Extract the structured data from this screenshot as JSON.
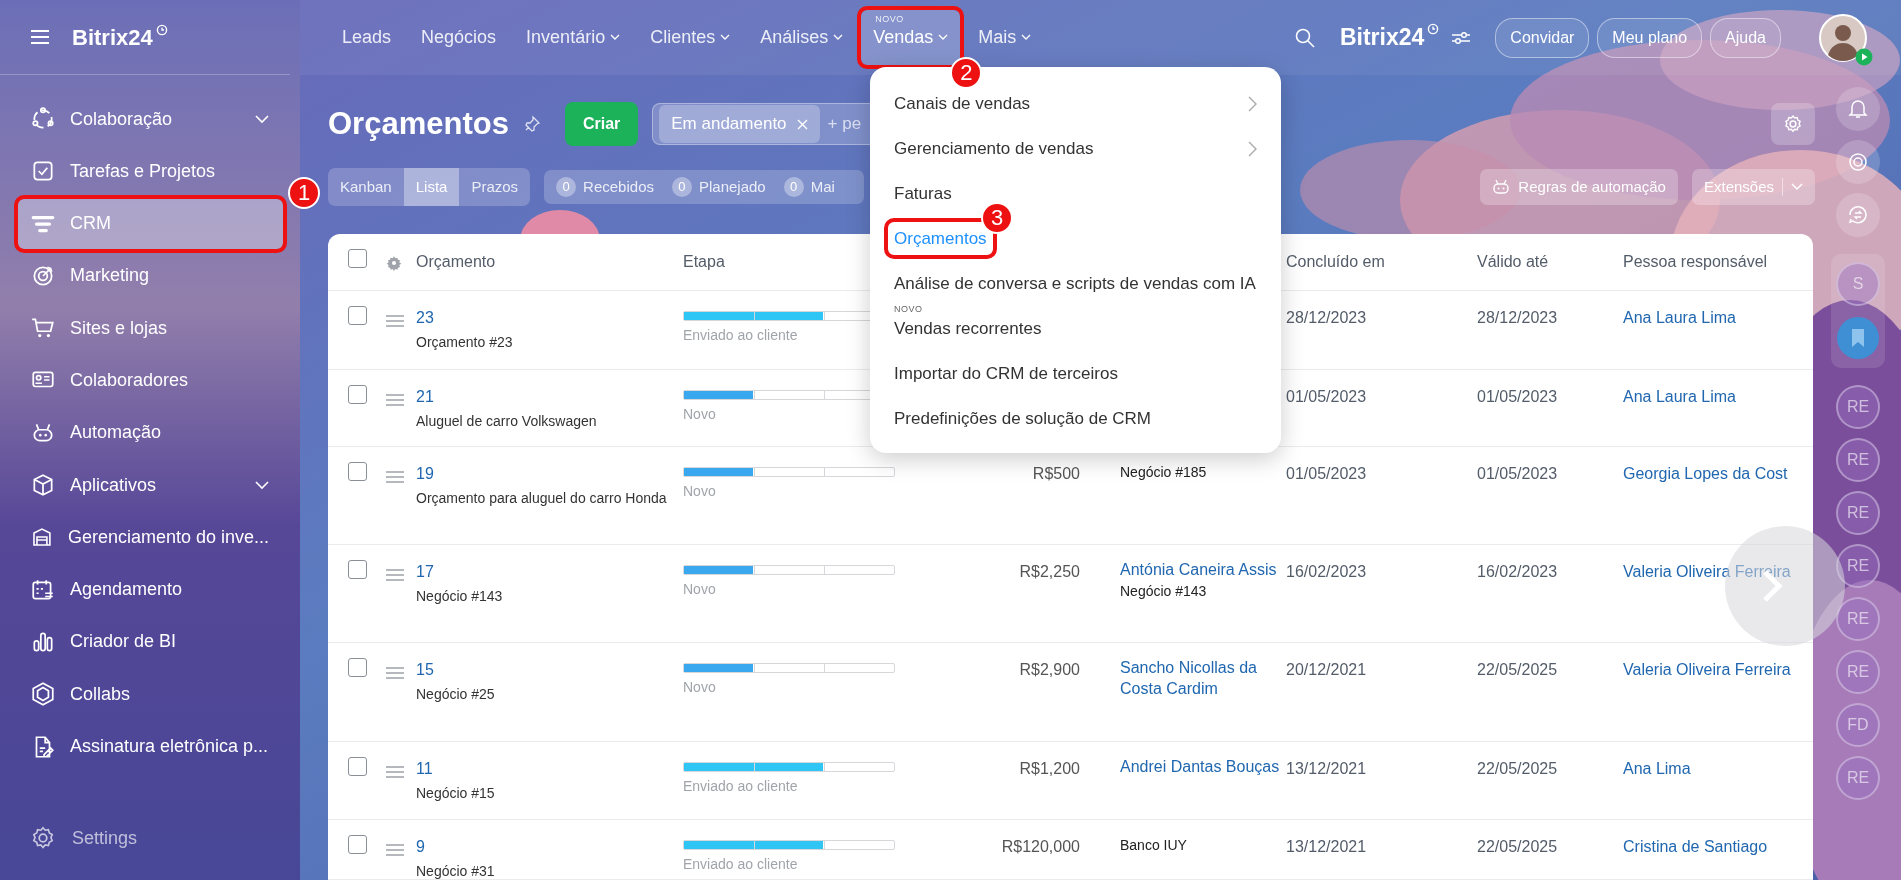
{
  "sidebar": {
    "logo": "Bitrix24",
    "items": [
      {
        "label": "Colaboração",
        "expandable": true,
        "selected": false
      },
      {
        "label": "Tarefas e Projetos",
        "expandable": false,
        "selected": false
      },
      {
        "label": "CRM",
        "expandable": false,
        "selected": true,
        "callout": "1"
      },
      {
        "label": "Marketing",
        "expandable": false,
        "selected": false
      },
      {
        "label": "Sites e lojas",
        "expandable": false,
        "selected": false
      },
      {
        "label": "Colaboradores",
        "expandable": false,
        "selected": false
      },
      {
        "label": "Automação",
        "expandable": false,
        "selected": false
      },
      {
        "label": "Aplicativos",
        "expandable": true,
        "selected": false
      },
      {
        "label": "Gerenciamento do inve...",
        "expandable": false,
        "selected": false
      },
      {
        "label": "Agendamento",
        "expandable": false,
        "selected": false
      },
      {
        "label": "Criador de BI",
        "expandable": false,
        "selected": false
      },
      {
        "label": "Collabs",
        "expandable": false,
        "selected": false
      },
      {
        "label": "Assinatura eletrônica p...",
        "expandable": false,
        "selected": false
      }
    ],
    "settings": "Settings"
  },
  "topbar": {
    "nav": [
      {
        "label": "Leads",
        "dropdown": false,
        "selected": false
      },
      {
        "label": "Negócios",
        "dropdown": false,
        "selected": false
      },
      {
        "label": "Inventário",
        "dropdown": true,
        "selected": false
      },
      {
        "label": "Clientes",
        "dropdown": true,
        "selected": false
      },
      {
        "label": "Análises",
        "dropdown": true,
        "selected": false
      },
      {
        "label": "Vendas",
        "dropdown": true,
        "selected": true,
        "badge": "NOVO",
        "callout": "2"
      },
      {
        "label": "Mais",
        "dropdown": true,
        "selected": false
      }
    ],
    "logo": "Bitrix24",
    "buttons": [
      "Convidar",
      "Meu plano",
      "Ajuda"
    ]
  },
  "menu": {
    "items": [
      {
        "label": "Canais de vendas",
        "submenu": true,
        "selected": false
      },
      {
        "label": "Gerenciamento de vendas",
        "submenu": true,
        "selected": false
      },
      {
        "label": "Faturas",
        "submenu": false,
        "selected": false
      },
      {
        "label": "Orçamentos",
        "submenu": false,
        "selected": true,
        "callout": "3"
      },
      {
        "label": "Análise de conversa e scripts de vendas com IA",
        "submenu": false,
        "selected": false
      },
      {
        "label": "Vendas recorrentes",
        "submenu": false,
        "selected": false,
        "badge": "NOVO"
      },
      {
        "label": "Importar do CRM de terceiros",
        "submenu": false,
        "selected": false
      },
      {
        "label": "Predefinições de solução de CRM",
        "submenu": false,
        "selected": false
      }
    ]
  },
  "page": {
    "title": "Orçamentos",
    "create_button": "Criar",
    "filter": {
      "chip": "Em andamento",
      "placeholder": "+ pe"
    },
    "views": [
      {
        "label": "Kanban",
        "selected": false
      },
      {
        "label": "Lista",
        "selected": true
      },
      {
        "label": "Prazos",
        "selected": false
      }
    ],
    "counters": [
      {
        "count": "0",
        "label": "Recebidos"
      },
      {
        "count": "0",
        "label": "Planejado"
      },
      {
        "count": "0",
        "label": "Mai"
      }
    ],
    "automation_button": "Regras de automação",
    "extensions_button": "Extensões"
  },
  "table": {
    "all_checked": false,
    "columns": [
      "Orçamento",
      "Etapa",
      "Concluído em",
      "Válido até",
      "Pessoa responsável"
    ],
    "rows": [
      {
        "checked": false,
        "number": "23",
        "title": "Orçamento #23",
        "stage": "Enviado ao cliente",
        "level": 0.66,
        "color": "#2fc6f6",
        "concluded": "28/12/2023",
        "valid": "28/12/2023",
        "responsible": "Ana Laura Lima"
      },
      {
        "checked": false,
        "number": "21",
        "title": "Aluguel de carro Volkswagen",
        "stage": "Novo",
        "level": 0.33,
        "color": "#39a8ef",
        "concluded": "01/05/2023",
        "valid": "01/05/2023",
        "responsible": "Ana Laura Lima"
      },
      {
        "checked": false,
        "number": "19",
        "title": "Orçamento para aluguel do carro Honda",
        "stage": "Novo",
        "level": 0.33,
        "color": "#39a8ef",
        "amount": "R$500",
        "client_note": "Negócio #185",
        "concluded": "01/05/2023",
        "valid": "01/05/2023",
        "responsible": "Georgia Lopes da Cost"
      },
      {
        "checked": false,
        "number": "17",
        "title": "Negócio #143",
        "stage": "Novo",
        "level": 0.33,
        "color": "#39a8ef",
        "amount": "R$2,250",
        "client": "Antónia Caneira Assis",
        "client_note": "Negócio #143",
        "concluded": "16/02/2023",
        "valid": "16/02/2023",
        "responsible": "Valeria Oliveira Ferreira"
      },
      {
        "checked": false,
        "number": "15",
        "title": "Negócio #25",
        "stage": "Novo",
        "level": 0.33,
        "color": "#39a8ef",
        "amount": "R$2,900",
        "client": "Sancho Nicollas da Costa Cardim",
        "concluded": "20/12/2021",
        "valid": "22/05/2025",
        "responsible": "Valeria Oliveira Ferreira"
      },
      {
        "checked": false,
        "number": "11",
        "title": "Negócio #15",
        "stage": "Enviado ao cliente",
        "level": 0.66,
        "color": "#2fc6f6",
        "amount": "R$1,200",
        "client": "Andrei Dantas Bouças",
        "concluded": "13/12/2021",
        "valid": "22/05/2025",
        "responsible": "Ana Lima"
      },
      {
        "checked": false,
        "number": "9",
        "title": "Negócio #31",
        "stage": "Enviado ao cliente",
        "level": 0.66,
        "color": "#2fc6f6",
        "amount": "R$120,000",
        "client_note": "Banco IUY",
        "concluded": "13/12/2021",
        "valid": "22/05/2025",
        "responsible": "Cristina de Santiago"
      }
    ]
  },
  "rail": {
    "avatars": [
      "S",
      "RE",
      "RE",
      "RE",
      "RE",
      "RE",
      "RE",
      "FD",
      "RE"
    ]
  }
}
